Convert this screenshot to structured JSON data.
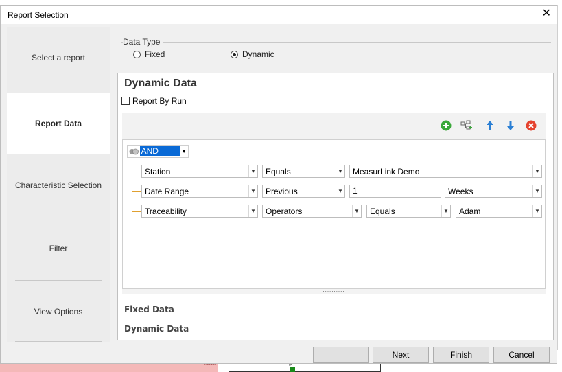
{
  "dialog": {
    "title": "Report Selection",
    "close_glyph": "✕"
  },
  "nav": {
    "items": [
      {
        "label": "Select a report"
      },
      {
        "label": "Report Data"
      },
      {
        "label": "Characteristic Selection"
      },
      {
        "label": "Filter"
      },
      {
        "label": "View Options"
      }
    ],
    "active_index": 1
  },
  "data_type": {
    "legend": "Data Type",
    "options": [
      {
        "label": "Fixed",
        "selected": false
      },
      {
        "label": "Dynamic",
        "selected": true
      }
    ]
  },
  "dynamic": {
    "title": "Dynamic Data",
    "report_by_run": {
      "label": "Report By Run",
      "checked": false
    },
    "toolbar_icons": [
      "add-icon",
      "add-group-icon",
      "move-up-icon",
      "move-down-icon",
      "delete-icon"
    ],
    "logic_operator": "AND",
    "rules": [
      {
        "field": "Station",
        "operator": "Equals",
        "value": "MeasurLink Demo"
      },
      {
        "field": "Date Range",
        "operator": "Previous",
        "value": "1",
        "unit": "Weeks"
      },
      {
        "field": "Traceability",
        "operator": "Operators",
        "operator2": "Equals",
        "value": "Adam"
      }
    ],
    "splitter": "..........",
    "sections": [
      "Fixed Data",
      "Dynamic Data"
    ]
  },
  "footer": {
    "next": "Next",
    "finish": "Finish",
    "cancel": "Cancel"
  },
  "colors": {
    "accent": "#0a6ad6",
    "add": "#3aa83a",
    "arrow": "#2a7fd4",
    "delete": "#e5432f",
    "tree": "#e0a030"
  }
}
